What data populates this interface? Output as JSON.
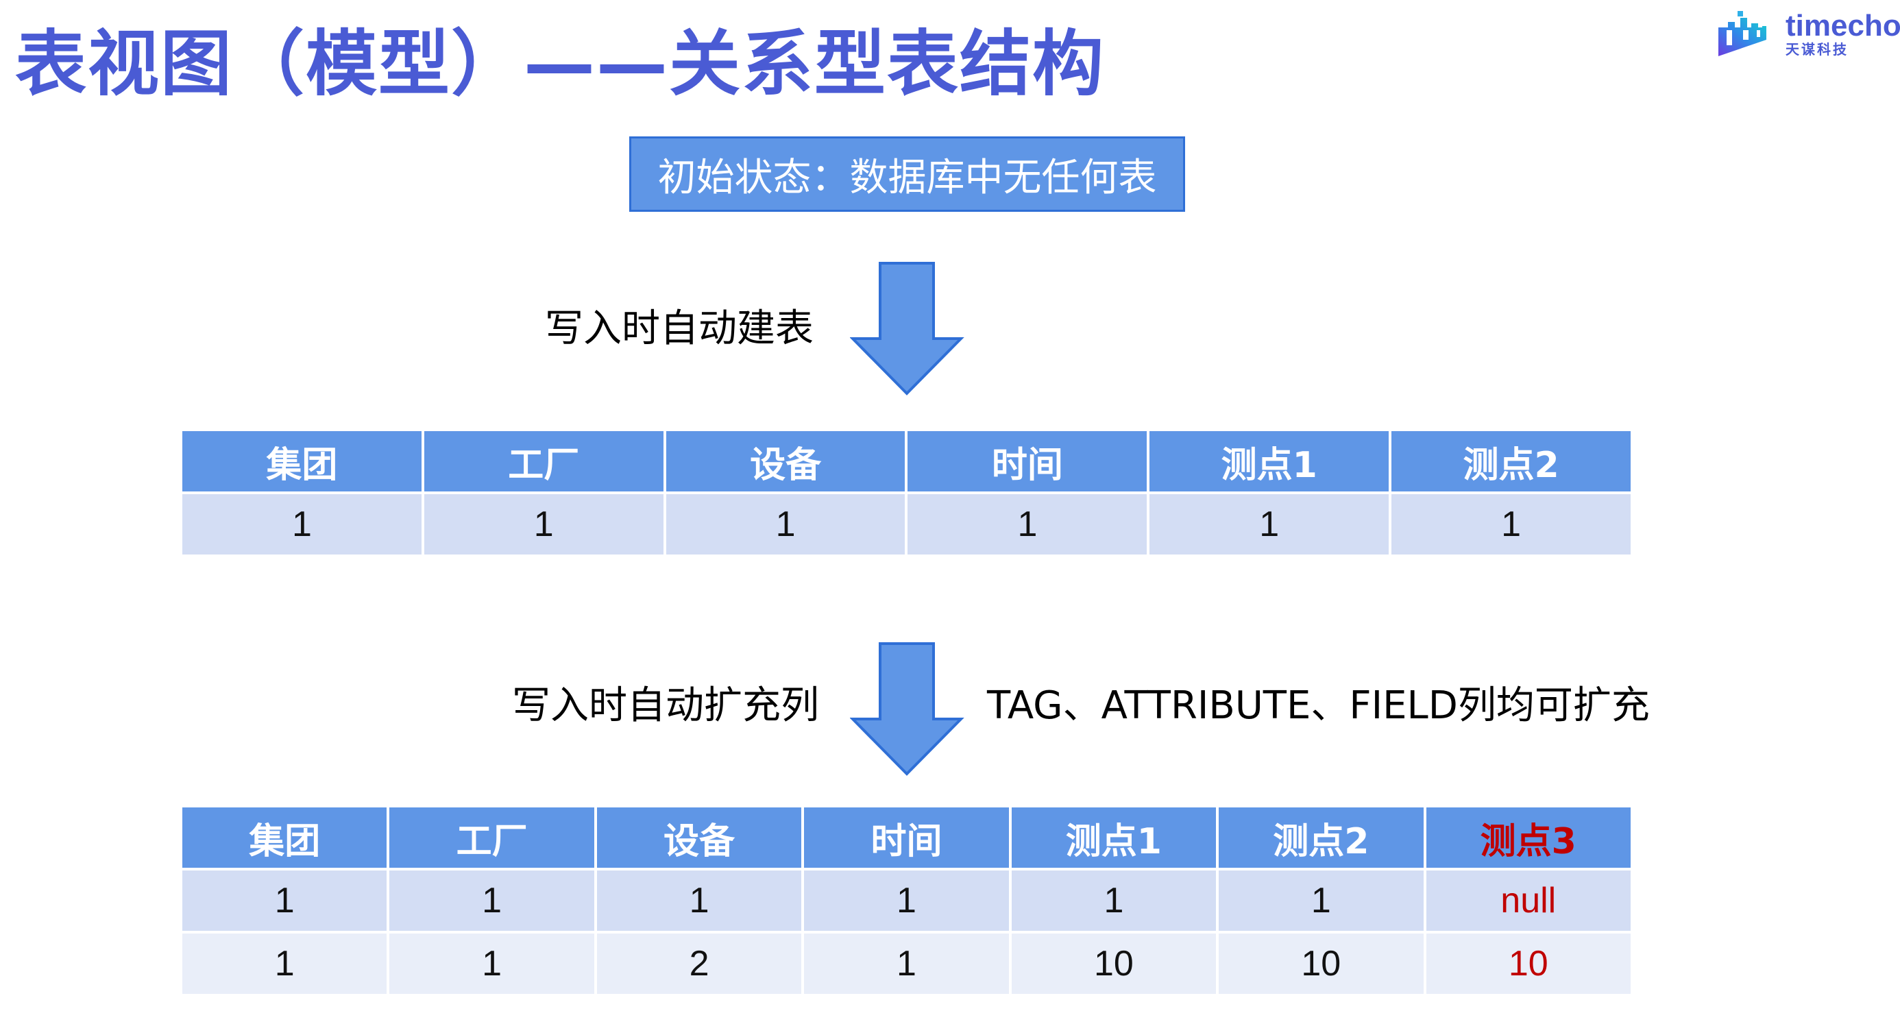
{
  "title": "表视图（模型）——关系型表结构",
  "logo": {
    "wordmark": "timecho",
    "subtitle": "天谋科技"
  },
  "initial_state": "初始状态：数据库中无任何表",
  "step1": {
    "label": "写入时自动建表"
  },
  "step2": {
    "label": "写入时自动扩充列",
    "note": "TAG、ATTRIBUTE、FIELD列均可扩充"
  },
  "colors": {
    "title": "#4a5bd4",
    "header_bg": "#5f96e6",
    "row_bg": "#d3ddf4",
    "row_alt_bg": "#e9eef9",
    "highlight": "#c00000"
  },
  "table1": {
    "columns": [
      "集团",
      "工厂",
      "设备",
      "时间",
      "测点1",
      "测点2"
    ],
    "rows": [
      [
        "1",
        "1",
        "1",
        "1",
        "1",
        "1"
      ]
    ]
  },
  "table2": {
    "columns": [
      "集团",
      "工厂",
      "设备",
      "时间",
      "测点1",
      "测点2",
      "测点3"
    ],
    "rows": [
      [
        "1",
        "1",
        "1",
        "1",
        "1",
        "1",
        "null"
      ],
      [
        "1",
        "1",
        "2",
        "1",
        "10",
        "10",
        "10"
      ]
    ]
  }
}
